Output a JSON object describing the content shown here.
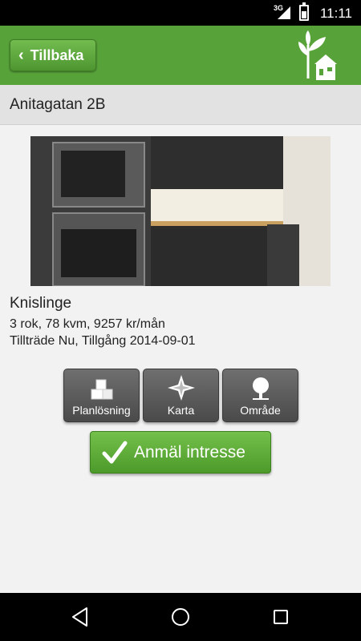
{
  "status_bar": {
    "network": "3G",
    "time": "11:11"
  },
  "app_bar": {
    "back_label": "Tillbaka",
    "logo_icon": "tree-house-icon",
    "brand_color": "#58a23a"
  },
  "listing": {
    "address": "Anitagatan 2B",
    "area": "Knislinge",
    "details": "3 rok, 78 kvm, 9257 kr/mån",
    "availability": "Tillträde Nu, Tillgång 2014-09-01"
  },
  "actions": [
    {
      "label": "Planlösning",
      "icon": "floorplan-icon"
    },
    {
      "label": "Karta",
      "icon": "compass-icon"
    },
    {
      "label": "Område",
      "icon": "tree-icon"
    }
  ],
  "interest_button": {
    "label": "Anmäl intresse",
    "icon": "checkmark-icon"
  },
  "nav_bar": {
    "back": "back-icon",
    "home": "home-icon",
    "recents": "recents-icon"
  }
}
